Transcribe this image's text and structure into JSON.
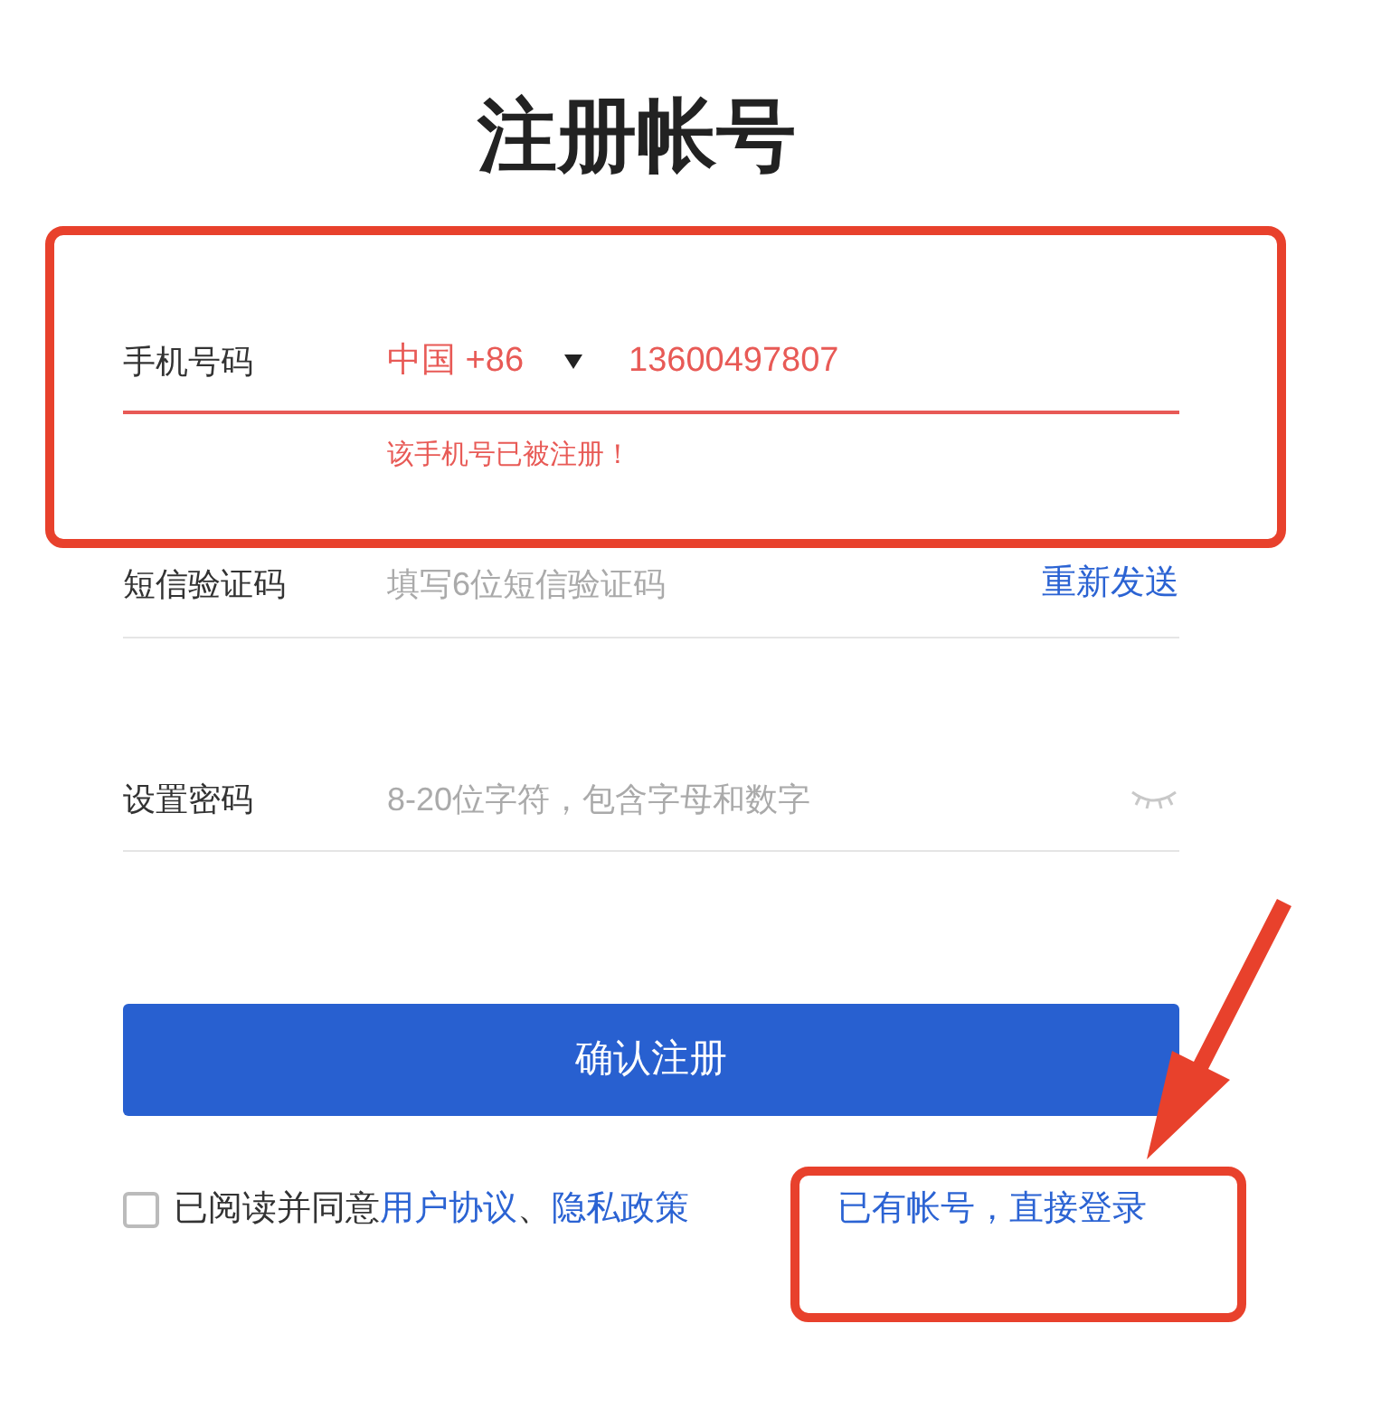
{
  "title": "注册帐号",
  "phone": {
    "label": "手机号码",
    "country": "中国 +86",
    "value": "13600497807",
    "error": "该手机号已被注册！",
    "invalid": true
  },
  "sms": {
    "label": "短信验证码",
    "placeholder": "填写6位短信验证码",
    "action": "重新发送"
  },
  "password": {
    "label": "设置密码",
    "placeholder": "8-20位字符，包含字母和数字"
  },
  "submit": "确认注册",
  "agreement": {
    "checked": false,
    "text": "已阅读并同意",
    "links": [
      "用户协议",
      "隐私政策"
    ],
    "separator": "、"
  },
  "login_link": "已有帐号，直接登录",
  "annotations": [
    {
      "kind": "box"
    },
    {
      "kind": "box"
    },
    {
      "kind": "arrow"
    }
  ]
}
